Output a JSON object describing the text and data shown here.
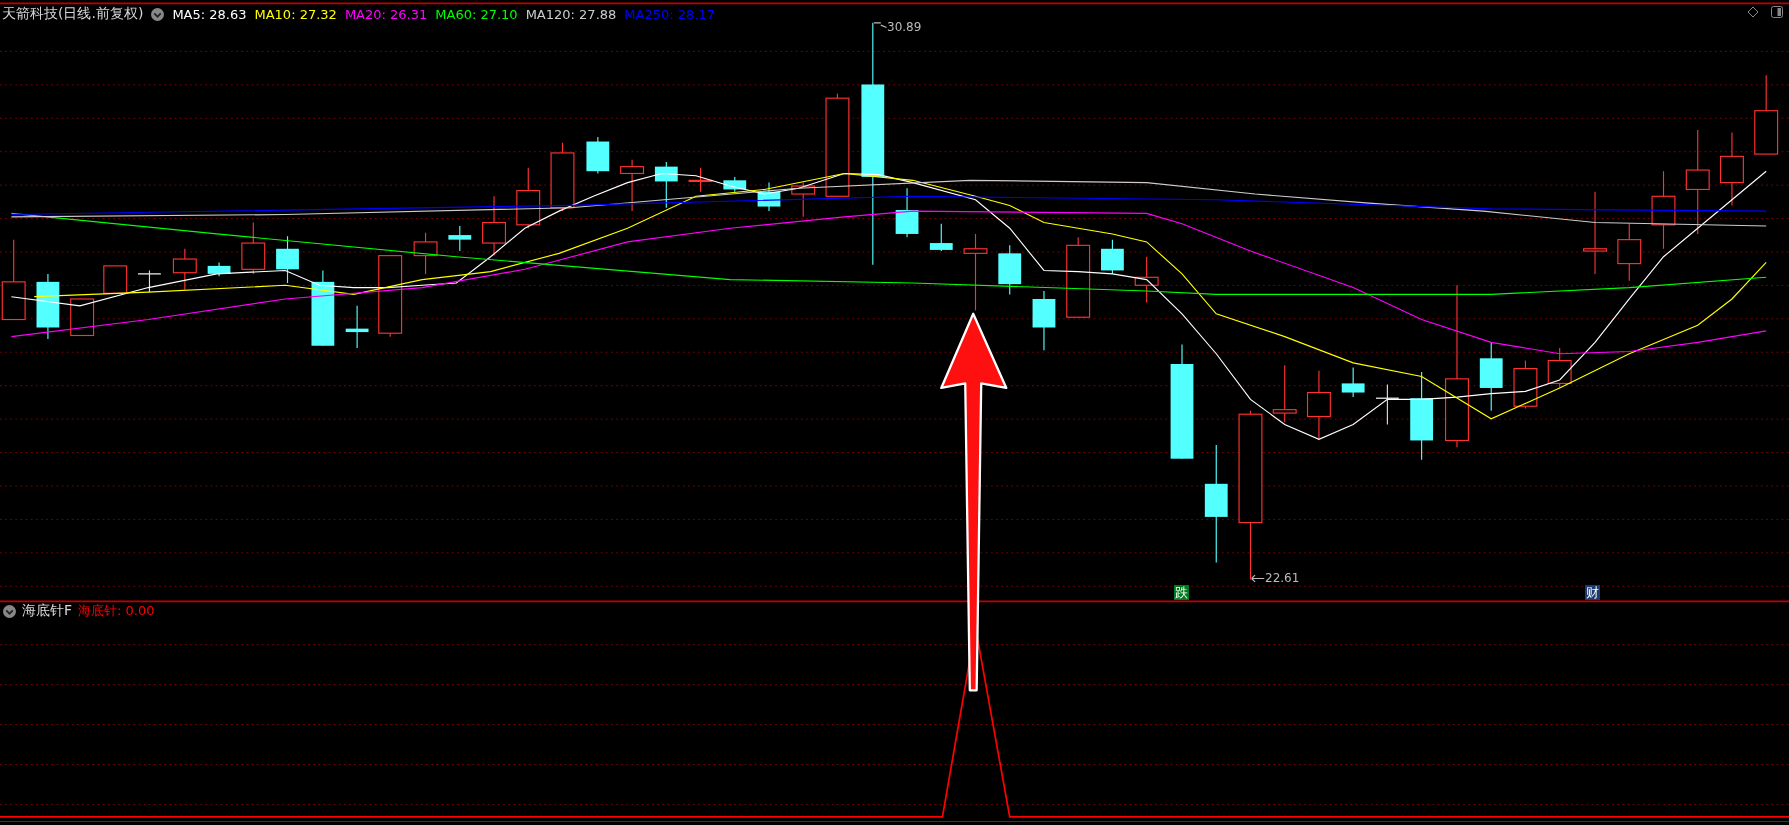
{
  "main_panel": {
    "title": "天箭科技(日线.前复权)",
    "indicators": [
      {
        "label": "MA5: 28.63",
        "color": "#ffffff"
      },
      {
        "label": "MA10: 27.32",
        "color": "#ffff00"
      },
      {
        "label": "MA20: 26.31",
        "color": "#ff00ff"
      },
      {
        "label": "MA60: 27.10",
        "color": "#00ff00"
      },
      {
        "label": "MA120: 27.88",
        "color": "#cccccc"
      },
      {
        "label": "MA250: 28.17",
        "color": "#0000ff"
      }
    ],
    "high_label": "30.89",
    "low_label": "22.61",
    "event_badges": [
      {
        "text": "跌",
        "color": "#007a1e"
      },
      {
        "text": "财",
        "color": "#1c3b6e"
      }
    ]
  },
  "lower_panel": {
    "title": "海底针F",
    "indicator": {
      "label": "海底针: 0.00",
      "color": "#ff0000"
    }
  }
}
